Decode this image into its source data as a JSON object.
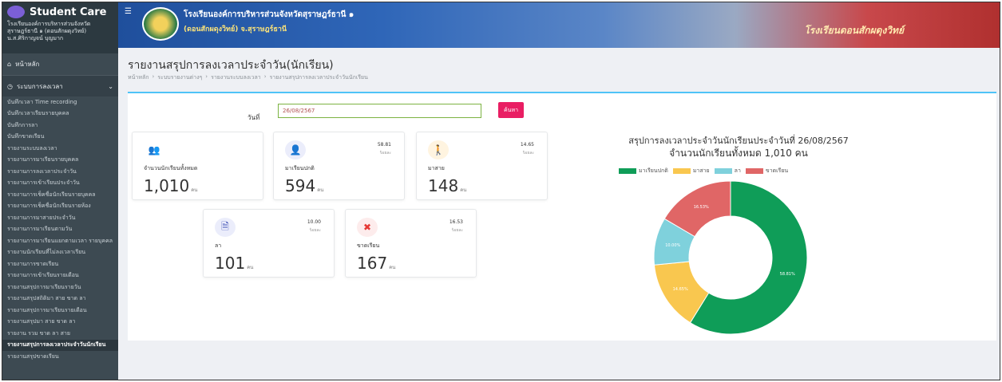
{
  "sidebar": {
    "brand_title": "Student Care",
    "brand_sub": [
      "โรงเรียนองค์การบริหารส่วนจังหวัด",
      "สุราษฎร์ธานี ๑ (ดอนสักผดุงวิทย์)",
      "น.ส.ศิริกาญจน์ บุญมาก"
    ],
    "home_label": "หน้าหลัก",
    "group_label": "ระบบการลงเวลา",
    "items": [
      "บันทึกเวลา Time recording",
      "บันทึกเวลาเรียนรายบุคคล",
      "บันทึกการลา",
      "บันทึกขาดเรียน",
      "รายงานระบบลงเวลา",
      "รายงานการมาเรียนรายบุคคล",
      "รายงานการลงเวลาประจำวัน",
      "รายงานการเข้าเรียนประจำวัน",
      "รายงานการเช็คชื่อนักเรียนรายบุคคล",
      "รายงานการเช็คชื่อนักเรียนรายห้อง",
      "รายงานการมาสายประจำวัน",
      "รายงานการมาเรียนตามวัน",
      "รายงานการมาเรียนแยกตามเวลา รายบุคคล",
      "รายงานนักเรียนที่ไม่ลงเวลาเรียน",
      "รายงานการขาดเรียน",
      "รายงานการเข้าเรียนรายเดือน",
      "รายงานสรุปการมาเรียนรายวัน",
      "รายงานสรุปสถิติมา สาย ขาด ลา",
      "รายงานสรุปการมาเรียนรายเดือน",
      "รายงานสรุปมา สาย ขาด ลา",
      "รายงาน รวม ขาด ลา สาย",
      "รายงานสรุปการลงเวลาประจำวันนักเรียน",
      "รายงานสรุปขาดเรียน"
    ],
    "active_index": 21
  },
  "banner": {
    "menu_icon": "hamburger-icon",
    "school_name": "โรงเรียนองค์การบริหารส่วนจังหวัดสุราษฎร์ธานี ๑",
    "school_sub": "(ดอนสักผดุงวิทย์) จ.สุราษฎร์ธานี",
    "photo_text": "โรงเรียนดอนสักผดุงวิทย์"
  },
  "page": {
    "title": "รายงานสรุปการลงเวลาประจำวัน(นักเรียน)",
    "breadcrumb": [
      "หน้าหลัก",
      "ระบบรายงานต่างๆ",
      "รายงานระบบลงเวลา",
      "รายงานสรุปการลงเวลาประจำวันนักเรียน"
    ]
  },
  "filter": {
    "date_label": "วันที่",
    "date_value": "26/08/2567",
    "search_label": "ค้นหา"
  },
  "stats": [
    {
      "key": "total",
      "label": "จำนวนนักเรียนทั้งหมด",
      "value": "1,010",
      "unit": "คน",
      "pct": "",
      "pct_sub": "",
      "icon": "students-icon",
      "color": "#4caf50"
    },
    {
      "key": "present",
      "label": "มาเรียนปกติ",
      "value": "594",
      "unit": "คน",
      "pct": "58.81",
      "pct_sub": "ร้อยละ",
      "icon": "user-check-icon",
      "color": "#5c6bc0"
    },
    {
      "key": "late",
      "label": "มาสาย",
      "value": "148",
      "unit": "คน",
      "pct": "14.65",
      "pct_sub": "ร้อยละ",
      "icon": "walking-icon",
      "color": "#ff9800"
    },
    {
      "key": "leave",
      "label": "ลา",
      "value": "101",
      "unit": "คน",
      "pct": "10.00",
      "pct_sub": "ร้อยละ",
      "icon": "document-icon",
      "color": "#3f51b5"
    },
    {
      "key": "absent",
      "label": "ขาดเรียน",
      "value": "167",
      "unit": "คน",
      "pct": "16.53",
      "pct_sub": "ร้อยละ",
      "icon": "absent-icon",
      "color": "#e53935"
    }
  ],
  "chart": {
    "title": "สรุปการลงเวลาประจำวันนักเรียนประจำวันที่ 26/08/2567",
    "subtitle": "จำนวนนักเรียนทั้งหมด 1,010 คน"
  },
  "chart_data": {
    "type": "pie",
    "donut": true,
    "title": "สรุปการลงเวลาประจำวันนักเรียนประจำวันที่ 26/08/2567",
    "subtitle": "จำนวนนักเรียนทั้งหมด 1,010 คน",
    "legend_position": "top",
    "series": [
      {
        "name": "มาเรียนปกติ",
        "value": 58.81,
        "label": "58.81%",
        "color": "#0f9d58"
      },
      {
        "name": "มาสาย",
        "value": 14.65,
        "label": "14.65%",
        "color": "#f9c74f"
      },
      {
        "name": "ลา",
        "value": 10.0,
        "label": "10.00%",
        "color": "#7fd1dc"
      },
      {
        "name": "ขาดเรียน",
        "value": 16.53,
        "label": "16.53%",
        "color": "#e06666"
      }
    ]
  }
}
